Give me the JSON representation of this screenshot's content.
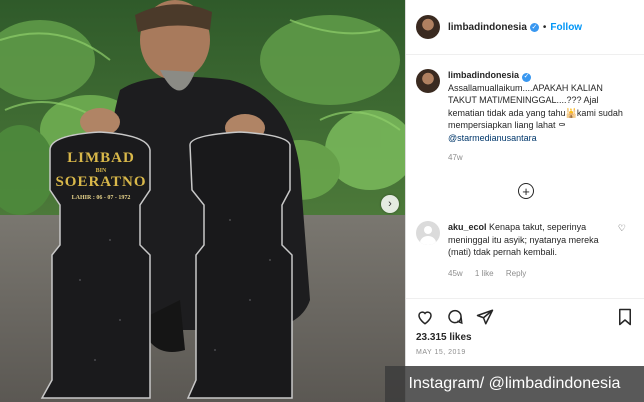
{
  "post": {
    "username": "limbadindonesia",
    "follow_label": "Follow",
    "separator": "•",
    "caption_user": "limbadindonesia",
    "caption_line1": "Assallamuallaikum....APAKAH KALIAN TAKUT MATI/MENINGGAL....??? Ajal kematian tidak ada yang tahu",
    "caption_emoji1": "🕌",
    "caption_line2": "kami sudah mempersiapkan liang lahat",
    "caption_emoji2": "⚰",
    "mention": "@starmedianusantara",
    "caption_time": "47w",
    "likes": "23.315 likes",
    "date": "MAY 15, 2019"
  },
  "comment": {
    "username": "aku_ecol",
    "text": "Kenapa takut, seperinya meninggal itu asyik; nyatanya mereka (mati) tdak pernah kembali.",
    "time": "45w",
    "likes": "1 like",
    "reply": "Reply"
  },
  "photo": {
    "headstone_name": "LIMBAD",
    "headstone_bin": "BIN",
    "headstone_father": "SOERATNO",
    "headstone_born": "LAHIR : 06 - 07 - 1972"
  },
  "watermark": "Instagram/ @limbadindonesia",
  "icons": [
    "verified-icon",
    "add-comment-icon",
    "heart-icon",
    "comment-icon",
    "share-icon",
    "bookmark-icon",
    "next-arrow-icon"
  ],
  "colors": {
    "accent": "#0095f6",
    "verified": "#3897f0",
    "text": "#262626",
    "muted": "#8e8e8e"
  }
}
